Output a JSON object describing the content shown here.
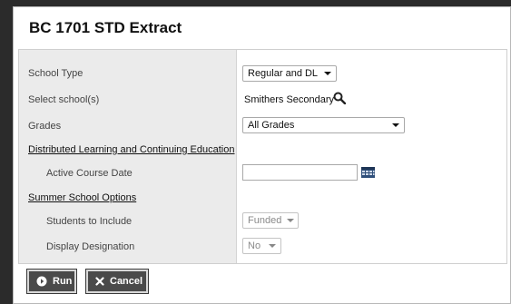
{
  "dialog": {
    "title": "BC 1701 STD Extract"
  },
  "form": {
    "school_type": {
      "label": "School Type",
      "value": "Regular and DL"
    },
    "select_school": {
      "label": "Select school(s)",
      "value": "Smithers Secondary"
    },
    "grades": {
      "label": "Grades",
      "value": "All Grades"
    },
    "dl_section": {
      "label": "Distributed Learning and Continuing Education"
    },
    "active_course_date": {
      "label": "Active Course Date",
      "value": ""
    },
    "summer_section": {
      "label": "Summer School Options"
    },
    "students_to_include": {
      "label": "Students to Include",
      "value": "Funded"
    },
    "display_designation": {
      "label": "Display Designation",
      "value": "No"
    }
  },
  "buttons": {
    "run": "Run",
    "cancel": "Cancel"
  },
  "icons": {
    "search": "search-icon",
    "calendar": "calendar-icon",
    "run": "play-circle-icon",
    "cancel": "close-icon"
  }
}
